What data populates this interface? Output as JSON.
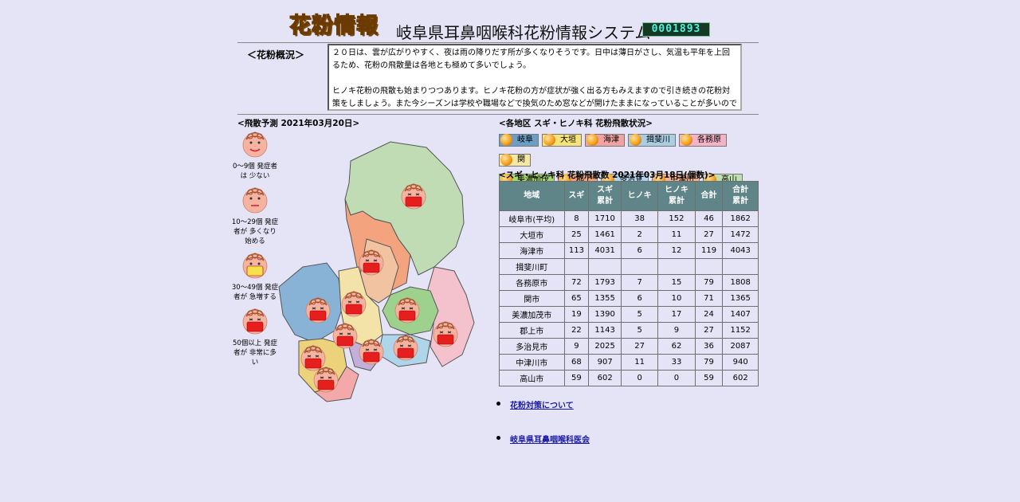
{
  "header": {
    "logo": "花粉情報",
    "title": "岐阜県耳鼻咽喉科花粉情報システム",
    "counter": "0001893"
  },
  "overview": {
    "label": "＜花粉概況＞",
    "paragraph1": "２０日は、雲が広がりやすく、夜は雨の降りだす所が多くなりそうです。日中は薄日がさし、気温も平年を上回るため、花粉の飛散量は各地とも極めて多いでしょう。",
    "paragraph2": "ヒノキ花粉の飛散も始まりつつあります。ヒノキ花粉の方が症状が強く出る方もみえますので引き続きの花粉対策をしましょう。また今シーズンは学校や職場などで換気のため窓などが開けたままになっていることが多いのでしっかりと花粉対策する事が必要です"
  },
  "forecast": {
    "label": "<飛散予測 2021年03月20日>"
  },
  "legend": [
    {
      "text": "0～9個 発症者は 少ない",
      "level": 0
    },
    {
      "text": "10～29個 発症者が 多くなり始める",
      "level": 1
    },
    {
      "text": "30～49個 発症者が 急増する",
      "level": 2
    },
    {
      "text": "50個以上 発症者が 非常に多い",
      "level": 3
    }
  ],
  "regions": {
    "label": "<各地区 スギ・ヒノキ科 花粉飛散状況>",
    "buttons": [
      {
        "label": "岐阜",
        "color": "#6b9ec6"
      },
      {
        "label": "大垣",
        "color": "#f5e27a"
      },
      {
        "label": "海津",
        "color": "#f3a2a2"
      },
      {
        "label": "揖斐川",
        "color": "#a9cde3"
      },
      {
        "label": "各務原",
        "color": "#f4b3c8"
      },
      {
        "label": "関",
        "color": "#f5e7a5"
      },
      {
        "label": "美濃加茂",
        "color": "#a6d96f"
      },
      {
        "label": "郡上",
        "color": "#f6a27a"
      },
      {
        "label": "多治見",
        "color": "#aed6ee"
      },
      {
        "label": "中津川",
        "color": "#f5b48f"
      },
      {
        "label": "高山",
        "color": "#bfe0b0"
      }
    ]
  },
  "table": {
    "label": "<スギ・ヒノキ科 花粉飛散数 2021年03月18日(個数)>",
    "headers": [
      "地域",
      "スギ",
      "スギ\n累計",
      "ヒノキ",
      "ヒノキ\n累計",
      "合計",
      "合計\n累計"
    ],
    "rows": [
      [
        "岐阜市(平均)",
        "8",
        "1710",
        "38",
        "152",
        "46",
        "1862"
      ],
      [
        "大垣市",
        "25",
        "1461",
        "2",
        "11",
        "27",
        "1472"
      ],
      [
        "海津市",
        "113",
        "4031",
        "6",
        "12",
        "119",
        "4043"
      ],
      [
        "揖斐川町",
        "",
        "",
        "",
        "",
        "",
        ""
      ],
      [
        "各務原市",
        "72",
        "1793",
        "7",
        "15",
        "79",
        "1808"
      ],
      [
        "関市",
        "65",
        "1355",
        "6",
        "10",
        "71",
        "1365"
      ],
      [
        "美濃加茂市",
        "19",
        "1390",
        "5",
        "17",
        "24",
        "1407"
      ],
      [
        "郡上市",
        "22",
        "1143",
        "5",
        "9",
        "27",
        "1152"
      ],
      [
        "多治見市",
        "9",
        "2025",
        "27",
        "62",
        "36",
        "2087"
      ],
      [
        "中津川市",
        "68",
        "907",
        "11",
        "33",
        "79",
        "940"
      ],
      [
        "高山市",
        "59",
        "602",
        "0",
        "0",
        "59",
        "602"
      ]
    ]
  },
  "links": [
    {
      "label": "花粉対策について"
    },
    {
      "label": "岐阜県耳鼻咽喉科医会"
    }
  ]
}
